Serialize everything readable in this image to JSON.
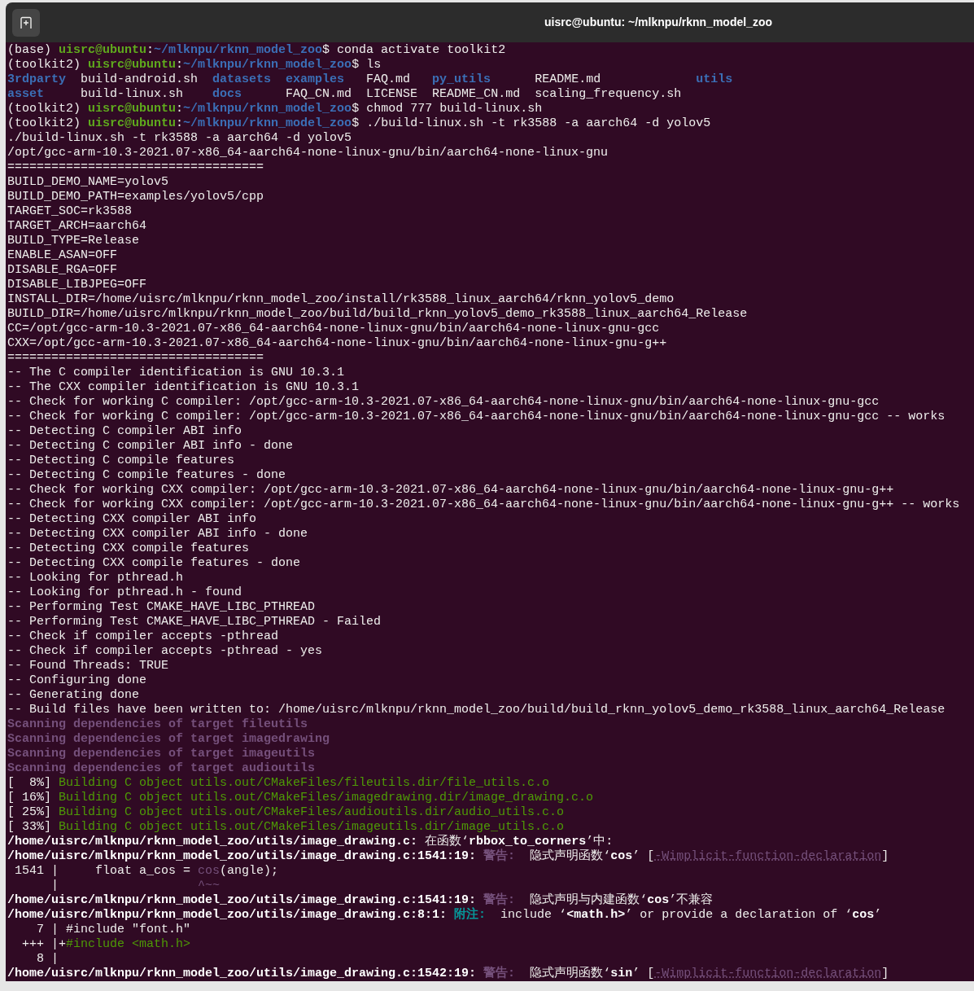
{
  "window": {
    "title": "uisrc@ubuntu: ~/mlknpu/rknn_model_zoo"
  },
  "lines": [
    {
      "segments": [
        {
          "text": "(base) ",
          "kind": "plain"
        },
        {
          "text": "uisrc@ubuntu",
          "kind": "user"
        },
        {
          "text": ":",
          "kind": "plain"
        },
        {
          "text": "~/mlknpu/rknn_model_zoo",
          "kind": "path"
        },
        {
          "text": "$ conda activate toolkit2",
          "kind": "plain"
        }
      ]
    },
    {
      "segments": [
        {
          "text": "(toolkit2) ",
          "kind": "plain"
        },
        {
          "text": "uisrc@ubuntu",
          "kind": "user"
        },
        {
          "text": ":",
          "kind": "plain"
        },
        {
          "text": "~/mlknpu/rknn_model_zoo",
          "kind": "path"
        },
        {
          "text": "$ ls",
          "kind": "plain"
        }
      ]
    },
    {
      "segments": [
        {
          "text": "3rdparty",
          "kind": "dir"
        },
        {
          "text": "  build-android.sh  ",
          "kind": "plain"
        },
        {
          "text": "datasets",
          "kind": "dir"
        },
        {
          "text": "  examples",
          "kind": "dir"
        },
        {
          "text": "   FAQ.md   ",
          "kind": "plain"
        },
        {
          "text": "py_utils",
          "kind": "dir"
        },
        {
          "text": "      README.md             ",
          "kind": "plain"
        },
        {
          "text": "utils",
          "kind": "dir"
        }
      ]
    },
    {
      "segments": [
        {
          "text": "asset",
          "kind": "dir"
        },
        {
          "text": "     build-linux.sh    ",
          "kind": "plain"
        },
        {
          "text": "docs",
          "kind": "dir"
        },
        {
          "text": "      FAQ_CN.md  LICENSE  README_CN.md  scaling_frequency.sh",
          "kind": "plain"
        }
      ]
    },
    {
      "segments": [
        {
          "text": "(toolkit2) ",
          "kind": "plain"
        },
        {
          "text": "uisrc@ubuntu",
          "kind": "user"
        },
        {
          "text": ":",
          "kind": "plain"
        },
        {
          "text": "~/mlknpu/rknn_model_zoo",
          "kind": "path"
        },
        {
          "text": "$ chmod 777 build-linux.sh",
          "kind": "plain"
        }
      ]
    },
    {
      "segments": [
        {
          "text": "(toolkit2) ",
          "kind": "plain"
        },
        {
          "text": "uisrc@ubuntu",
          "kind": "user"
        },
        {
          "text": ":",
          "kind": "plain"
        },
        {
          "text": "~/mlknpu/rknn_model_zoo",
          "kind": "path"
        },
        {
          "text": "$ ./build-linux.sh -t rk3588 -a aarch64 -d yolov5",
          "kind": "plain"
        }
      ]
    },
    {
      "segments": [
        {
          "text": "./build-linux.sh -t rk3588 -a aarch64 -d yolov5",
          "kind": "plain"
        }
      ]
    },
    {
      "segments": [
        {
          "text": "/opt/gcc-arm-10.3-2021.07-x86_64-aarch64-none-linux-gnu/bin/aarch64-none-linux-gnu",
          "kind": "plain"
        }
      ]
    },
    {
      "segments": [
        {
          "text": "===================================",
          "kind": "plain"
        }
      ]
    },
    {
      "segments": [
        {
          "text": "BUILD_DEMO_NAME=yolov5",
          "kind": "plain"
        }
      ]
    },
    {
      "segments": [
        {
          "text": "BUILD_DEMO_PATH=examples/yolov5/cpp",
          "kind": "plain"
        }
      ]
    },
    {
      "segments": [
        {
          "text": "TARGET_SOC=rk3588",
          "kind": "plain"
        }
      ]
    },
    {
      "segments": [
        {
          "text": "TARGET_ARCH=aarch64",
          "kind": "plain"
        }
      ]
    },
    {
      "segments": [
        {
          "text": "BUILD_TYPE=Release",
          "kind": "plain"
        }
      ]
    },
    {
      "segments": [
        {
          "text": "ENABLE_ASAN=OFF",
          "kind": "plain"
        }
      ]
    },
    {
      "segments": [
        {
          "text": "DISABLE_RGA=OFF",
          "kind": "plain"
        }
      ]
    },
    {
      "segments": [
        {
          "text": "DISABLE_LIBJPEG=OFF",
          "kind": "plain"
        }
      ]
    },
    {
      "segments": [
        {
          "text": "INSTALL_DIR=/home/uisrc/mlknpu/rknn_model_zoo/install/rk3588_linux_aarch64/rknn_yolov5_demo",
          "kind": "plain"
        }
      ]
    },
    {
      "segments": [
        {
          "text": "BUILD_DIR=/home/uisrc/mlknpu/rknn_model_zoo/build/build_rknn_yolov5_demo_rk3588_linux_aarch64_Release",
          "kind": "plain"
        }
      ]
    },
    {
      "segments": [
        {
          "text": "CC=/opt/gcc-arm-10.3-2021.07-x86_64-aarch64-none-linux-gnu/bin/aarch64-none-linux-gnu-gcc",
          "kind": "plain"
        }
      ]
    },
    {
      "segments": [
        {
          "text": "CXX=/opt/gcc-arm-10.3-2021.07-x86_64-aarch64-none-linux-gnu/bin/aarch64-none-linux-gnu-g++",
          "kind": "plain"
        }
      ]
    },
    {
      "segments": [
        {
          "text": "===================================",
          "kind": "plain"
        }
      ]
    },
    {
      "segments": [
        {
          "text": "-- The C compiler identification is GNU 10.3.1",
          "kind": "plain"
        }
      ]
    },
    {
      "segments": [
        {
          "text": "-- The CXX compiler identification is GNU 10.3.1",
          "kind": "plain"
        }
      ]
    },
    {
      "segments": [
        {
          "text": "-- Check for working C compiler: /opt/gcc-arm-10.3-2021.07-x86_64-aarch64-none-linux-gnu/bin/aarch64-none-linux-gnu-gcc",
          "kind": "plain"
        }
      ]
    },
    {
      "segments": [
        {
          "text": "-- Check for working C compiler: /opt/gcc-arm-10.3-2021.07-x86_64-aarch64-none-linux-gnu/bin/aarch64-none-linux-gnu-gcc -- works",
          "kind": "plain"
        }
      ]
    },
    {
      "segments": [
        {
          "text": "-- Detecting C compiler ABI info",
          "kind": "plain"
        }
      ]
    },
    {
      "segments": [
        {
          "text": "-- Detecting C compiler ABI info - done",
          "kind": "plain"
        }
      ]
    },
    {
      "segments": [
        {
          "text": "-- Detecting C compile features",
          "kind": "plain"
        }
      ]
    },
    {
      "segments": [
        {
          "text": "-- Detecting C compile features - done",
          "kind": "plain"
        }
      ]
    },
    {
      "segments": [
        {
          "text": "-- Check for working CXX compiler: /opt/gcc-arm-10.3-2021.07-x86_64-aarch64-none-linux-gnu/bin/aarch64-none-linux-gnu-g++",
          "kind": "plain"
        }
      ]
    },
    {
      "segments": [
        {
          "text": "-- Check for working CXX compiler: /opt/gcc-arm-10.3-2021.07-x86_64-aarch64-none-linux-gnu/bin/aarch64-none-linux-gnu-g++ -- works",
          "kind": "plain"
        }
      ]
    },
    {
      "segments": [
        {
          "text": "-- Detecting CXX compiler ABI info",
          "kind": "plain"
        }
      ]
    },
    {
      "segments": [
        {
          "text": "-- Detecting CXX compiler ABI info - done",
          "kind": "plain"
        }
      ]
    },
    {
      "segments": [
        {
          "text": "-- Detecting CXX compile features",
          "kind": "plain"
        }
      ]
    },
    {
      "segments": [
        {
          "text": "-- Detecting CXX compile features - done",
          "kind": "plain"
        }
      ]
    },
    {
      "segments": [
        {
          "text": "-- Looking for pthread.h",
          "kind": "plain"
        }
      ]
    },
    {
      "segments": [
        {
          "text": "-- Looking for pthread.h - found",
          "kind": "plain"
        }
      ]
    },
    {
      "segments": [
        {
          "text": "-- Performing Test CMAKE_HAVE_LIBC_PTHREAD",
          "kind": "plain"
        }
      ]
    },
    {
      "segments": [
        {
          "text": "-- Performing Test CMAKE_HAVE_LIBC_PTHREAD - Failed",
          "kind": "plain"
        }
      ]
    },
    {
      "segments": [
        {
          "text": "-- Check if compiler accepts -pthread",
          "kind": "plain"
        }
      ]
    },
    {
      "segments": [
        {
          "text": "-- Check if compiler accepts -pthread - yes",
          "kind": "plain"
        }
      ]
    },
    {
      "segments": [
        {
          "text": "-- Found Threads: TRUE",
          "kind": "plain"
        }
      ]
    },
    {
      "segments": [
        {
          "text": "-- Configuring done",
          "kind": "plain"
        }
      ]
    },
    {
      "segments": [
        {
          "text": "-- Generating done",
          "kind": "plain"
        }
      ]
    },
    {
      "segments": [
        {
          "text": "-- Build files have been written to: /home/uisrc/mlknpu/rknn_model_zoo/build/build_rknn_yolov5_demo_rk3588_linux_aarch64_Release",
          "kind": "plain"
        }
      ]
    },
    {
      "segments": [
        {
          "text": "Scanning dependencies of target fileutils",
          "kind": "scan"
        }
      ]
    },
    {
      "segments": [
        {
          "text": "Scanning dependencies of target imagedrawing",
          "kind": "scan"
        }
      ]
    },
    {
      "segments": [
        {
          "text": "Scanning dependencies of target imageutils",
          "kind": "scan"
        }
      ]
    },
    {
      "segments": [
        {
          "text": "Scanning dependencies of target audioutils",
          "kind": "scan"
        }
      ]
    },
    {
      "segments": [
        {
          "text": "[  8%] ",
          "kind": "plain"
        },
        {
          "text": "Building C object utils.out/CMakeFiles/fileutils.dir/file_utils.c.o",
          "kind": "build"
        }
      ]
    },
    {
      "segments": [
        {
          "text": "[ 16%] ",
          "kind": "plain"
        },
        {
          "text": "Building C object utils.out/CMakeFiles/imagedrawing.dir/image_drawing.c.o",
          "kind": "build"
        }
      ]
    },
    {
      "segments": [
        {
          "text": "[ 25%] ",
          "kind": "plain"
        },
        {
          "text": "Building C object utils.out/CMakeFiles/audioutils.dir/audio_utils.c.o",
          "kind": "build"
        }
      ]
    },
    {
      "segments": [
        {
          "text": "[ 33%] ",
          "kind": "plain"
        },
        {
          "text": "Building C object utils.out/CMakeFiles/imageutils.dir/image_utils.c.o",
          "kind": "build"
        }
      ]
    },
    {
      "segments": [
        {
          "text": "/home/uisrc/mlknpu/rknn_model_zoo/utils/image_drawing.c:",
          "kind": "bold"
        },
        {
          "text": " 在函数‘",
          "kind": "plain"
        },
        {
          "text": "rbbox_to_corners",
          "kind": "bold"
        },
        {
          "text": "’中:",
          "kind": "plain"
        }
      ]
    },
    {
      "segments": [
        {
          "text": "/home/uisrc/mlknpu/rknn_model_zoo/utils/image_drawing.c:1541:19: ",
          "kind": "bold"
        },
        {
          "text": "警告:",
          "kind": "warn"
        },
        {
          "text": "  隐式声明函数‘",
          "kind": "plain"
        },
        {
          "text": "cos",
          "kind": "bold"
        },
        {
          "text": "’ [",
          "kind": "plain"
        },
        {
          "text": "-Wimplicit-function-declaration",
          "kind": "option"
        },
        {
          "text": "]",
          "kind": "plain"
        }
      ]
    },
    {
      "segments": [
        {
          "text": " 1541 |     float a_cos = ",
          "kind": "plain"
        },
        {
          "text": "cos",
          "kind": "flag"
        },
        {
          "text": "(angle);",
          "kind": "plain"
        }
      ]
    },
    {
      "segments": [
        {
          "text": "      |                   ",
          "kind": "plain"
        },
        {
          "text": "^~~",
          "kind": "flag"
        }
      ]
    },
    {
      "segments": [
        {
          "text": "/home/uisrc/mlknpu/rknn_model_zoo/utils/image_drawing.c:1541:19: ",
          "kind": "bold"
        },
        {
          "text": "警告:",
          "kind": "warn"
        },
        {
          "text": "  隐式声明与内建函数‘",
          "kind": "plain"
        },
        {
          "text": "cos",
          "kind": "bold"
        },
        {
          "text": "’不兼容",
          "kind": "plain"
        }
      ]
    },
    {
      "segments": [
        {
          "text": "/home/uisrc/mlknpu/rknn_model_zoo/utils/image_drawing.c:8:1: ",
          "kind": "bold"
        },
        {
          "text": "附注:",
          "kind": "note"
        },
        {
          "text": "  include ‘",
          "kind": "plain"
        },
        {
          "text": "<math.h>",
          "kind": "bold"
        },
        {
          "text": "’ or provide a declaration of ‘",
          "kind": "plain"
        },
        {
          "text": "cos",
          "kind": "bold"
        },
        {
          "text": "’",
          "kind": "plain"
        }
      ]
    },
    {
      "segments": [
        {
          "text": "    7 | #include \"font.h\"",
          "kind": "plain"
        }
      ]
    },
    {
      "segments": [
        {
          "text": "  +++ |+",
          "kind": "plain"
        },
        {
          "text": "#include <math.h>",
          "kind": "build"
        }
      ]
    },
    {
      "segments": [
        {
          "text": "    8 |",
          "kind": "plain"
        }
      ]
    },
    {
      "segments": [
        {
          "text": "/home/uisrc/mlknpu/rknn_model_zoo/utils/image_drawing.c:1542:19: ",
          "kind": "bold"
        },
        {
          "text": "警告:",
          "kind": "warn"
        },
        {
          "text": "  隐式声明函数‘",
          "kind": "plain"
        },
        {
          "text": "sin",
          "kind": "bold"
        },
        {
          "text": "’ [",
          "kind": "plain"
        },
        {
          "text": "-Wimplicit-function-declaration",
          "kind": "option"
        },
        {
          "text": "]",
          "kind": "plain"
        }
      ]
    }
  ]
}
